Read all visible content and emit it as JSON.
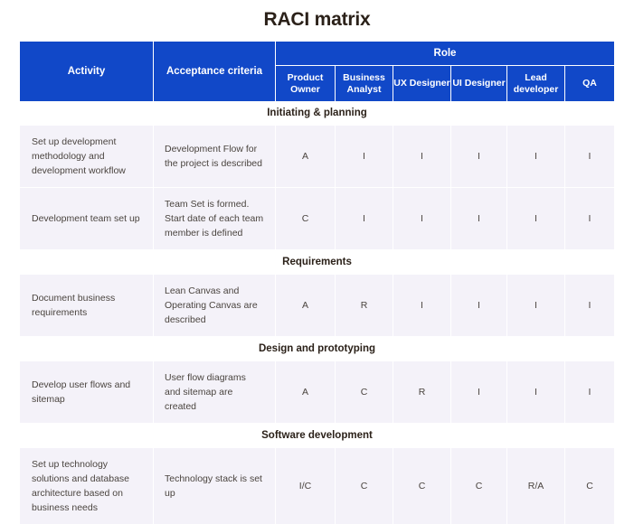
{
  "page": {
    "title": "RACI matrix",
    "accent_color": "#1148c8",
    "row_background": "#f4f2f9",
    "text_color": "#2b2119"
  },
  "table": {
    "headers": {
      "activity": "Activity",
      "acceptance_criteria": "Acceptance criteria",
      "role_group": "Role",
      "roles": [
        "Product Owner",
        "Business Analyst",
        "UX Designer",
        "UI Designer",
        "Lead developer",
        "QA"
      ]
    },
    "sections": [
      {
        "name": "Initiating & planning",
        "rows": [
          {
            "activity": "Set up development methodology and development workflow",
            "acceptance_criteria": "Development Flow for the project is described",
            "assignments": [
              "A",
              "I",
              "I",
              "I",
              "I",
              "I"
            ]
          },
          {
            "activity": "Development team set up",
            "acceptance_criteria": "Team Set is formed. Start date of each team member is defined",
            "assignments": [
              "C",
              "I",
              "I",
              "I",
              "I",
              "I"
            ]
          }
        ]
      },
      {
        "name": "Requirements",
        "rows": [
          {
            "activity": "Document business requirements",
            "acceptance_criteria": "Lean Canvas and Operating Canvas are described",
            "assignments": [
              "A",
              "R",
              "I",
              "I",
              "I",
              "I"
            ]
          }
        ]
      },
      {
        "name": "Design and prototyping",
        "rows": [
          {
            "activity": "Develop user flows and sitemap",
            "acceptance_criteria": "User flow diagrams and sitemap are created",
            "assignments": [
              "A",
              "C",
              "R",
              "I",
              "I",
              "I"
            ]
          }
        ]
      },
      {
        "name": "Software development",
        "rows": [
          {
            "activity": "Set up technology solutions and database architecture based on business needs",
            "acceptance_criteria": "Technology stack is set up",
            "assignments": [
              "I/C",
              "C",
              "C",
              "C",
              "R/A",
              "C"
            ]
          }
        ]
      }
    ]
  }
}
